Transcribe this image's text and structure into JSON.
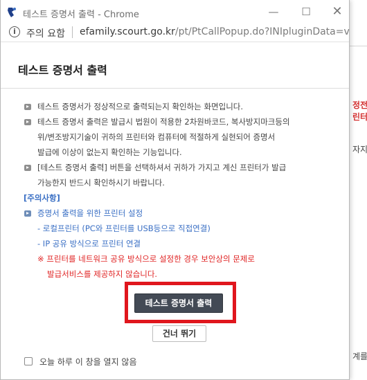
{
  "window": {
    "title": "테스트 증명서 출력 - Chrome",
    "controls": {
      "minimize": "—",
      "maximize": "☐",
      "close": "✕"
    }
  },
  "address_bar": {
    "security_label": "주의 요함",
    "url_host": "efamily.scourt.go.kr",
    "url_path": "/pt/PtCallPopup.do?INIpluginData=vf..."
  },
  "popup": {
    "title": "테스트 증명서 출력",
    "lines": [
      "테스트 증명서가 정상적으로 출력되는지 확인하는 화면입니다.",
      "테스트 증명서 출력은 발급시 법원이 적용한 2차원바코드, 복사방지마크등의",
      "위/변조방지기술이 귀하의 프린터와 컴퓨터에 적절하게 실현되어 증명서",
      "발급에 이상이 없는지 확인하는 기능입니다.",
      "[테스트 증명서 출력] 버튼을 선택하셔서 귀하가 가지고 계신 프린터가 발급",
      "가능한지 반드시 확인하시기 바랍니다."
    ],
    "notice_heading": "[주의사항]",
    "printer_setup": "증명서 출력을 위한 프린터 설정",
    "local_printer": "- 로컬프린터 (PC와 프린터를 USB등으로 직접연결)",
    "ip_printer": "- IP 공유 방식으로 프린터 연결",
    "warning_1": "※ 프린터를 네트워크 공유 방식으로 설정한 경우 보안상의 문제로",
    "warning_2": "발급서비스를 제공하지 않습니다.",
    "print_button": "테스트 증명서 출력",
    "skip_button": "건너 뛰기",
    "dont_show_today": "오늘 하루 이 창을 열지 않음"
  },
  "background_page": {
    "fragment_1": "정전",
    "fragment_2": "린터",
    "fragment_3": "자지",
    "fragment_4": "계를"
  },
  "colors": {
    "highlight_red": "#e0161d",
    "button_dark": "#434a55",
    "notice_blue": "#3a6fc4",
    "warning_red": "#e02424"
  }
}
